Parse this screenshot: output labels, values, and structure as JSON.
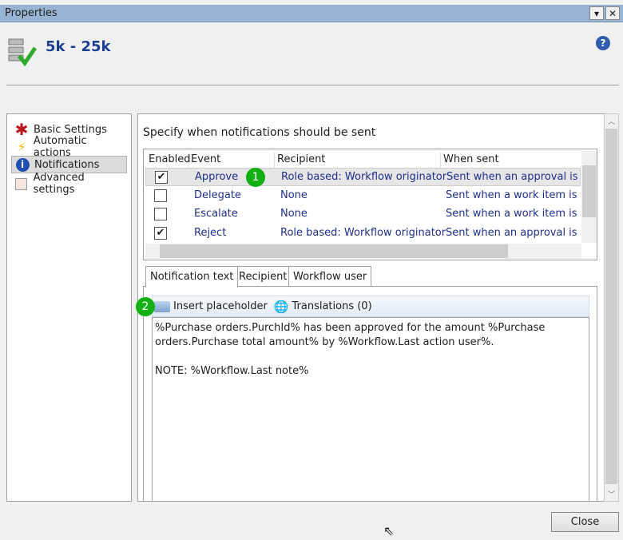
{
  "window": {
    "title": "Properties",
    "menu_icon": "▾",
    "close_icon": "✕"
  },
  "header": {
    "title": "5k - 25k",
    "help": "?"
  },
  "nav": {
    "items": [
      {
        "label": "Basic Settings",
        "icon": "star-icon"
      },
      {
        "label": "Automatic actions",
        "icon": "lightning-icon"
      },
      {
        "label": "Notifications",
        "icon": "info-icon"
      },
      {
        "label": "Advanced settings",
        "icon": "settings-icon"
      }
    ]
  },
  "panel": {
    "heading": "Specify when notifications should be sent"
  },
  "grid": {
    "headers": [
      "Enabled",
      "Event",
      "Recipient",
      "When sent"
    ],
    "rows": [
      {
        "enabled": true,
        "event": "Approve",
        "recipient": "Role based: Workflow originator",
        "when": "Sent when an approval is Approved"
      },
      {
        "enabled": false,
        "event": "Delegate",
        "recipient": "None",
        "when": "Sent when a work item is delegated"
      },
      {
        "enabled": false,
        "event": "Escalate",
        "recipient": "None",
        "when": "Sent when a work item is escalated"
      },
      {
        "enabled": true,
        "event": "Reject",
        "recipient": "Role based: Workflow originator",
        "when": "Sent when an approval is Rejected"
      }
    ]
  },
  "callouts": [
    "1",
    "2"
  ],
  "tabs": [
    "Notification text",
    "Recipient",
    "Workflow user"
  ],
  "toolbar": {
    "insert": "Insert placeholder",
    "translations": "Translations (0)"
  },
  "notification_text": "%Purchase orders.PurchId% has been approved for the amount %Purchase orders.Purchase total amount% by %Workflow.Last action user%.\n\nNOTE: %Workflow.Last note%",
  "close_label": "Close"
}
